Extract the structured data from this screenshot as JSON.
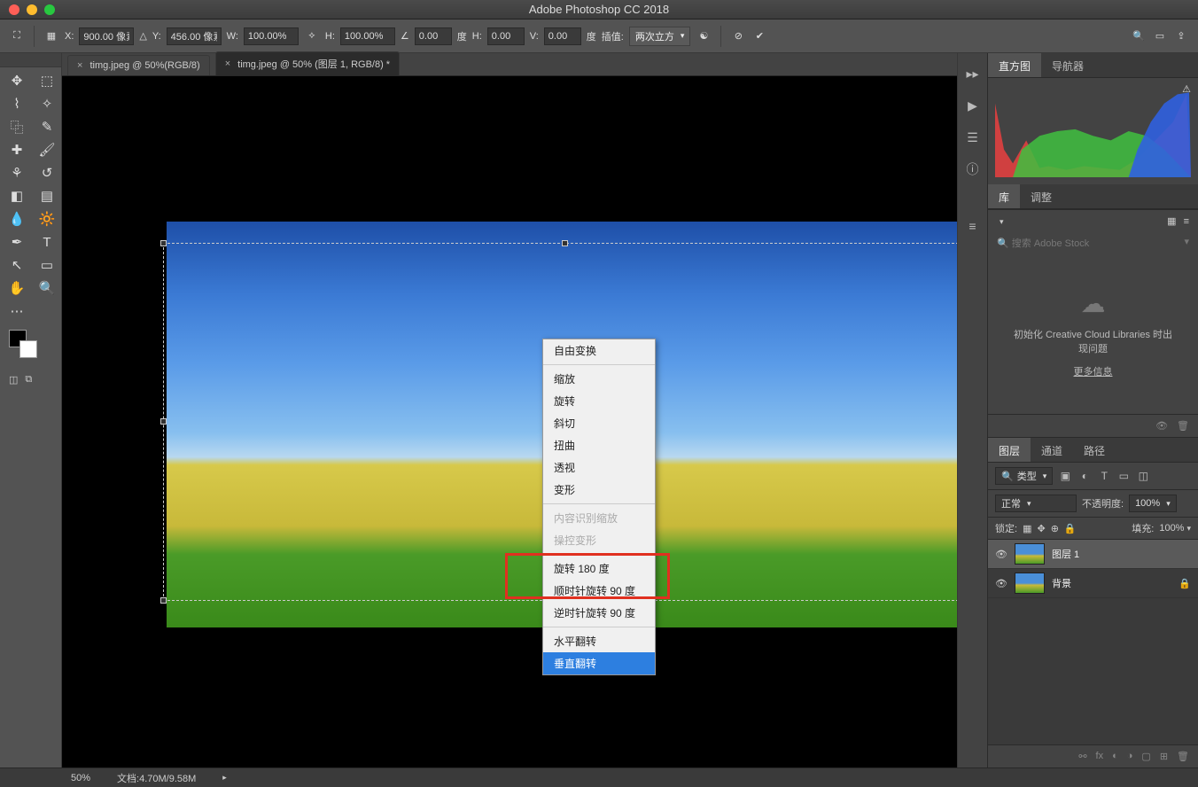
{
  "app_title": "Adobe Photoshop CC 2018",
  "options": {
    "x_label": "X:",
    "x_value": "900.00 像素",
    "tri_label": "△",
    "y_label": "Y:",
    "y_value": "456.00 像素",
    "w_label": "W:",
    "w_value": "100.00%",
    "h_label": "H:",
    "h_value": "100.00%",
    "ang_label": "∠",
    "ang_value": "0.00",
    "ang_unit": "度",
    "h2_label": "H:",
    "h2_value": "0.00",
    "v_label": "V:",
    "v_value": "0.00",
    "v_unit": "度",
    "interp_label": "插值:",
    "interp_value": "两次立方"
  },
  "tabs": [
    {
      "label": "timg.jpeg @ 50%(RGB/8)",
      "active": false
    },
    {
      "label": "timg.jpeg @ 50% (图层 1, RGB/8) *",
      "active": true
    }
  ],
  "context_menu": {
    "title": "自由变换",
    "items1": [
      "缩放",
      "旋转",
      "斜切",
      "扭曲",
      "透视",
      "变形"
    ],
    "disabled": [
      "内容识别缩放",
      "操控变形"
    ],
    "items2": [
      "旋转 180 度",
      "顺时针旋转 90 度",
      "逆时针旋转 90 度"
    ],
    "flip_h": "水平翻转",
    "flip_v": "垂直翻转"
  },
  "right_panel": {
    "tabs1": [
      "直方图",
      "导航器"
    ],
    "tabs2": [
      "库",
      "调整"
    ],
    "search_placeholder": "搜索 Adobe Stock",
    "lib_msg1": "初始化 Creative Cloud Libraries 时出",
    "lib_msg2": "现问题",
    "lib_link": "更多信息",
    "tabs3": [
      "图层",
      "通道",
      "路径"
    ],
    "kind": "类型",
    "blend": "正常",
    "opacity_label": "不透明度:",
    "opacity": "100%",
    "lock_label": "锁定:",
    "fill_label": "填充:",
    "fill": "100%",
    "layers": [
      {
        "name": "图层 1",
        "locked": false,
        "selected": true
      },
      {
        "name": "背景",
        "locked": true,
        "selected": false
      }
    ]
  },
  "status": {
    "zoom": "50%",
    "doc": "文档:4.70M/9.58M"
  }
}
